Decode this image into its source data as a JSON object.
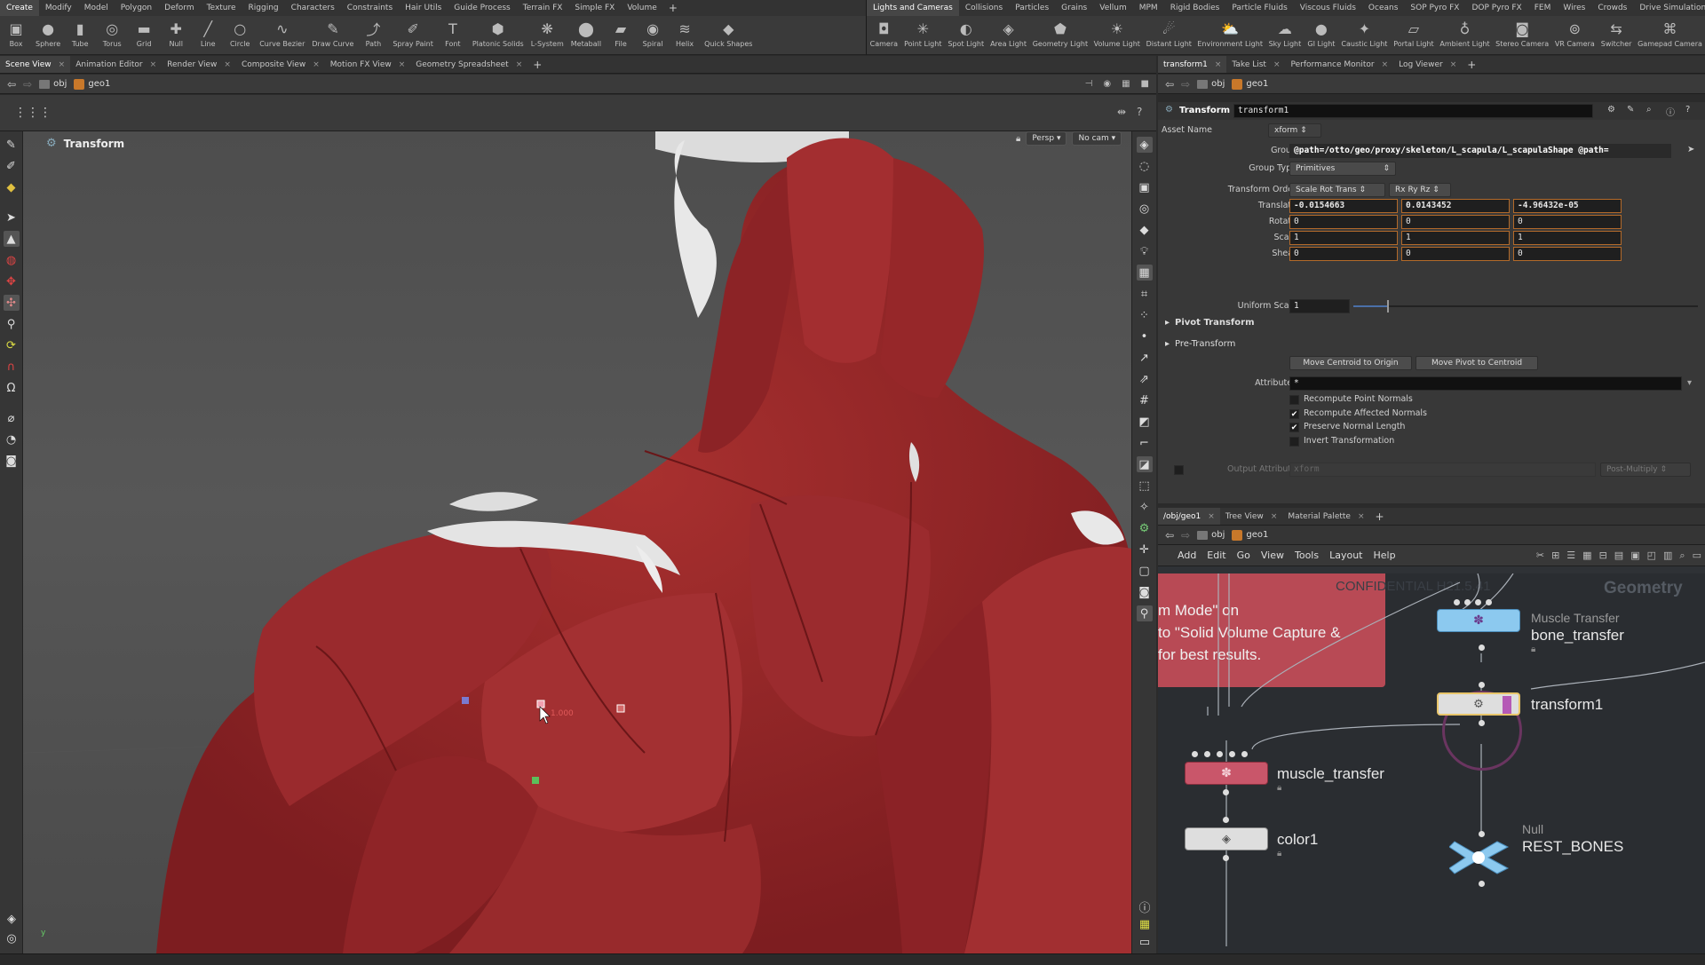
{
  "shelf_left": {
    "tabs": [
      "Create",
      "Modify",
      "Model",
      "Polygon",
      "Deform",
      "Texture",
      "Rigging",
      "Characters",
      "Constraints",
      "Hair Utils",
      "Guide Process",
      "Terrain FX",
      "Simple FX",
      "Volume"
    ],
    "active_tab": "Create",
    "tools": [
      {
        "label": "Box",
        "icon": "box-icon",
        "glyph": "▣"
      },
      {
        "label": "Sphere",
        "icon": "sphere-icon",
        "glyph": "●"
      },
      {
        "label": "Tube",
        "icon": "tube-icon",
        "glyph": "▮"
      },
      {
        "label": "Torus",
        "icon": "torus-icon",
        "glyph": "◎"
      },
      {
        "label": "Grid",
        "icon": "grid-icon",
        "glyph": "▬"
      },
      {
        "label": "Null",
        "icon": "null-icon",
        "glyph": "✚"
      },
      {
        "label": "Line",
        "icon": "line-icon",
        "glyph": "╱"
      },
      {
        "label": "Circle",
        "icon": "circle-icon",
        "glyph": "○"
      },
      {
        "label": "Curve Bezier",
        "icon": "curve-bezier-icon",
        "glyph": "∿"
      },
      {
        "label": "Draw Curve",
        "icon": "draw-curve-icon",
        "glyph": "✎"
      },
      {
        "label": "Path",
        "icon": "path-icon",
        "glyph": "⤴"
      },
      {
        "label": "Spray Paint",
        "icon": "spray-paint-icon",
        "glyph": "✐"
      },
      {
        "label": "Font",
        "icon": "font-icon",
        "glyph": "T"
      },
      {
        "label": "Platonic Solids",
        "icon": "platonic-solids-icon",
        "glyph": "⬢"
      },
      {
        "label": "L-System",
        "icon": "l-system-icon",
        "glyph": "❋"
      },
      {
        "label": "Metaball",
        "icon": "metaball-icon",
        "glyph": "⬤"
      },
      {
        "label": "File",
        "icon": "file-icon",
        "glyph": "▰"
      },
      {
        "label": "Spiral",
        "icon": "spiral-icon",
        "glyph": "◉"
      },
      {
        "label": "Helix",
        "icon": "helix-icon",
        "glyph": "≋"
      },
      {
        "label": "Quick Shapes",
        "icon": "quick-shapes-icon",
        "glyph": "◆"
      }
    ]
  },
  "shelf_right": {
    "tabs": [
      "Lights and Cameras",
      "Collisions",
      "Particles",
      "Grains",
      "Vellum",
      "MPM",
      "Rigid Bodies",
      "Particle Fluids",
      "Viscous Fluids",
      "Oceans",
      "SOP Pyro FX",
      "DOP Pyro FX",
      "FEM",
      "Wires",
      "Crowds",
      "Drive Simulation"
    ],
    "active_tab": "Lights and Cameras",
    "tools": [
      {
        "label": "Camera",
        "icon": "camera-icon",
        "glyph": "◘"
      },
      {
        "label": "Point Light",
        "icon": "point-light-icon",
        "glyph": "✳"
      },
      {
        "label": "Spot Light",
        "icon": "spot-light-icon",
        "glyph": "◐"
      },
      {
        "label": "Area Light",
        "icon": "area-light-icon",
        "glyph": "◈"
      },
      {
        "label": "Geometry Light",
        "icon": "geometry-light-icon",
        "glyph": "⬟"
      },
      {
        "label": "Volume Light",
        "icon": "volume-light-icon",
        "glyph": "☀"
      },
      {
        "label": "Distant Light",
        "icon": "distant-light-icon",
        "glyph": "☄"
      },
      {
        "label": "Environment Light",
        "icon": "environment-light-icon",
        "glyph": "⛅"
      },
      {
        "label": "Sky Light",
        "icon": "sky-light-icon",
        "glyph": "☁"
      },
      {
        "label": "GI Light",
        "icon": "gi-light-icon",
        "glyph": "●"
      },
      {
        "label": "Caustic Light",
        "icon": "caustic-light-icon",
        "glyph": "✦"
      },
      {
        "label": "Portal Light",
        "icon": "portal-light-icon",
        "glyph": "▱"
      },
      {
        "label": "Ambient Light",
        "icon": "ambient-light-icon",
        "glyph": "♁"
      },
      {
        "label": "Stereo Camera",
        "icon": "stereo-camera-icon",
        "glyph": "◙"
      },
      {
        "label": "VR Camera",
        "icon": "vr-camera-icon",
        "glyph": "⊚"
      },
      {
        "label": "Switcher",
        "icon": "switcher-icon",
        "glyph": "⇆"
      },
      {
        "label": "Gamepad Camera",
        "icon": "gamepad-camera-icon",
        "glyph": "⌘"
      }
    ]
  },
  "left_pane": {
    "tabs": [
      "Scene View",
      "Animation Editor",
      "Render View",
      "Composite View",
      "Motion FX View",
      "Geometry Spreadsheet"
    ],
    "path": [
      "obj",
      "geo1"
    ],
    "viewport_title": "Transform",
    "persp_label": "Persp",
    "cam_label": "No cam",
    "handle_readout": "1.000"
  },
  "param_pane": {
    "tabs": [
      "transform1",
      "Take List",
      "Performance Monitor",
      "Log Viewer"
    ],
    "path": [
      "obj",
      "geo1"
    ],
    "node_type": "Transform",
    "node_name": "transform1",
    "asset_name_label": "Asset Name",
    "asset_name": "xform",
    "group_label": "Group",
    "group_value": "@path=/otto/geo/proxy/skeleton/L_scapula/L_scapulaShape @path=",
    "group_type_label": "Group Type",
    "group_type": "Primitives",
    "transform_order_label": "Transform Order",
    "transform_order": "Scale Rot Trans",
    "rot_order": "Rx Ry Rz",
    "rows": [
      {
        "label": "Translate",
        "values": [
          "-0.0154663",
          "0.0143452",
          "-4.96432e-05"
        ]
      },
      {
        "label": "Rotate",
        "values": [
          "0",
          "0",
          "0"
        ]
      },
      {
        "label": "Scale",
        "values": [
          "1",
          "1",
          "1"
        ]
      },
      {
        "label": "Shear",
        "values": [
          "0",
          "0",
          "0"
        ]
      }
    ],
    "uniform_scale_label": "Uniform Scale",
    "uniform_scale": "1",
    "pivot_transform": "Pivot Transform",
    "pre_transform": "Pre-Transform",
    "move_centroid_btn": "Move Centroid to Origin",
    "move_pivot_btn": "Move Pivot to Centroid",
    "attributes_label": "Attributes",
    "attributes_value": "*",
    "checkboxes": [
      {
        "label": "Recompute Point Normals",
        "checked": false,
        "mark": ""
      },
      {
        "label": "Recompute Affected Normals",
        "checked": true,
        "mark": "✔"
      },
      {
        "label": "Preserve Normal Length",
        "checked": true,
        "mark": "✔"
      },
      {
        "label": "Invert Transformation",
        "checked": false,
        "mark": ""
      }
    ],
    "output_attribute_label": "Output Attribute",
    "output_attribute": "xform",
    "post_multiply": "Post-Multiply"
  },
  "network_pane": {
    "tabs": [
      "/obj/geo1",
      "Tree View",
      "Material Palette"
    ],
    "path": [
      "obj",
      "geo1"
    ],
    "menu": [
      "Add",
      "Edit",
      "Go",
      "View",
      "Tools",
      "Layout",
      "Help"
    ],
    "watermark": "CONFIDENTIAL H21.5.41",
    "context_label": "Geometry",
    "sticky_lines": [
      "m Mode\" on",
      "to \"Solid Volume Capture &",
      "for best results."
    ],
    "nodes": [
      {
        "type": "Muscle Transfer",
        "name": "bone_transfer",
        "color": "#7fc3ee"
      },
      {
        "type": "",
        "name": "transform1",
        "color": "#d9d9d9"
      },
      {
        "type": "",
        "name": "muscle_transfer",
        "color": "#c9566a"
      },
      {
        "type": "",
        "name": "color1",
        "color": "#d9d9d9"
      },
      {
        "type": "Null",
        "name": "REST_BONES",
        "color": "#7fc3ee"
      }
    ]
  },
  "colors": {
    "muscle": "#9e2a2e",
    "bone": "#e6e6e6",
    "sticky": "#b84a55",
    "selected_node": "#e8c56a"
  }
}
